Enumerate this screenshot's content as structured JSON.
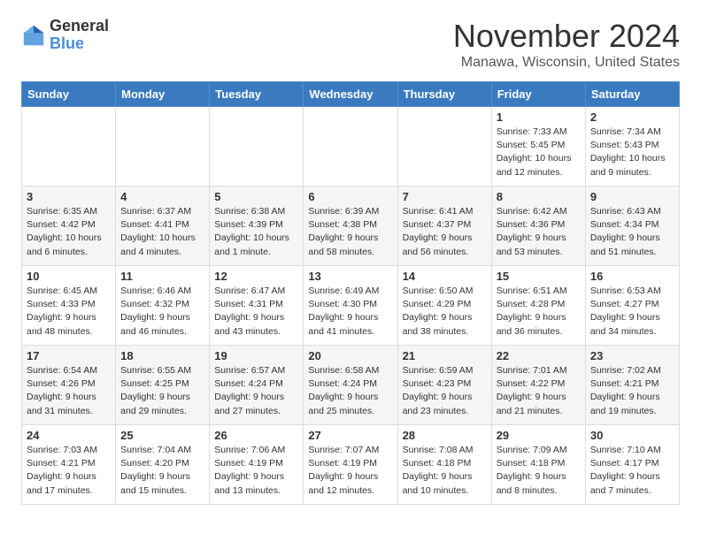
{
  "logo": {
    "general": "General",
    "blue": "Blue"
  },
  "header": {
    "month": "November 2024",
    "location": "Manawa, Wisconsin, United States"
  },
  "days_of_week": [
    "Sunday",
    "Monday",
    "Tuesday",
    "Wednesday",
    "Thursday",
    "Friday",
    "Saturday"
  ],
  "weeks": [
    [
      {
        "day": "",
        "info": ""
      },
      {
        "day": "",
        "info": ""
      },
      {
        "day": "",
        "info": ""
      },
      {
        "day": "",
        "info": ""
      },
      {
        "day": "",
        "info": ""
      },
      {
        "day": "1",
        "info": "Sunrise: 7:33 AM\nSunset: 5:45 PM\nDaylight: 10 hours and 12 minutes."
      },
      {
        "day": "2",
        "info": "Sunrise: 7:34 AM\nSunset: 5:43 PM\nDaylight: 10 hours and 9 minutes."
      }
    ],
    [
      {
        "day": "3",
        "info": "Sunrise: 6:35 AM\nSunset: 4:42 PM\nDaylight: 10 hours and 6 minutes."
      },
      {
        "day": "4",
        "info": "Sunrise: 6:37 AM\nSunset: 4:41 PM\nDaylight: 10 hours and 4 minutes."
      },
      {
        "day": "5",
        "info": "Sunrise: 6:38 AM\nSunset: 4:39 PM\nDaylight: 10 hours and 1 minute."
      },
      {
        "day": "6",
        "info": "Sunrise: 6:39 AM\nSunset: 4:38 PM\nDaylight: 9 hours and 58 minutes."
      },
      {
        "day": "7",
        "info": "Sunrise: 6:41 AM\nSunset: 4:37 PM\nDaylight: 9 hours and 56 minutes."
      },
      {
        "day": "8",
        "info": "Sunrise: 6:42 AM\nSunset: 4:36 PM\nDaylight: 9 hours and 53 minutes."
      },
      {
        "day": "9",
        "info": "Sunrise: 6:43 AM\nSunset: 4:34 PM\nDaylight: 9 hours and 51 minutes."
      }
    ],
    [
      {
        "day": "10",
        "info": "Sunrise: 6:45 AM\nSunset: 4:33 PM\nDaylight: 9 hours and 48 minutes."
      },
      {
        "day": "11",
        "info": "Sunrise: 6:46 AM\nSunset: 4:32 PM\nDaylight: 9 hours and 46 minutes."
      },
      {
        "day": "12",
        "info": "Sunrise: 6:47 AM\nSunset: 4:31 PM\nDaylight: 9 hours and 43 minutes."
      },
      {
        "day": "13",
        "info": "Sunrise: 6:49 AM\nSunset: 4:30 PM\nDaylight: 9 hours and 41 minutes."
      },
      {
        "day": "14",
        "info": "Sunrise: 6:50 AM\nSunset: 4:29 PM\nDaylight: 9 hours and 38 minutes."
      },
      {
        "day": "15",
        "info": "Sunrise: 6:51 AM\nSunset: 4:28 PM\nDaylight: 9 hours and 36 minutes."
      },
      {
        "day": "16",
        "info": "Sunrise: 6:53 AM\nSunset: 4:27 PM\nDaylight: 9 hours and 34 minutes."
      }
    ],
    [
      {
        "day": "17",
        "info": "Sunrise: 6:54 AM\nSunset: 4:26 PM\nDaylight: 9 hours and 31 minutes."
      },
      {
        "day": "18",
        "info": "Sunrise: 6:55 AM\nSunset: 4:25 PM\nDaylight: 9 hours and 29 minutes."
      },
      {
        "day": "19",
        "info": "Sunrise: 6:57 AM\nSunset: 4:24 PM\nDaylight: 9 hours and 27 minutes."
      },
      {
        "day": "20",
        "info": "Sunrise: 6:58 AM\nSunset: 4:24 PM\nDaylight: 9 hours and 25 minutes."
      },
      {
        "day": "21",
        "info": "Sunrise: 6:59 AM\nSunset: 4:23 PM\nDaylight: 9 hours and 23 minutes."
      },
      {
        "day": "22",
        "info": "Sunrise: 7:01 AM\nSunset: 4:22 PM\nDaylight: 9 hours and 21 minutes."
      },
      {
        "day": "23",
        "info": "Sunrise: 7:02 AM\nSunset: 4:21 PM\nDaylight: 9 hours and 19 minutes."
      }
    ],
    [
      {
        "day": "24",
        "info": "Sunrise: 7:03 AM\nSunset: 4:21 PM\nDaylight: 9 hours and 17 minutes."
      },
      {
        "day": "25",
        "info": "Sunrise: 7:04 AM\nSunset: 4:20 PM\nDaylight: 9 hours and 15 minutes."
      },
      {
        "day": "26",
        "info": "Sunrise: 7:06 AM\nSunset: 4:19 PM\nDaylight: 9 hours and 13 minutes."
      },
      {
        "day": "27",
        "info": "Sunrise: 7:07 AM\nSunset: 4:19 PM\nDaylight: 9 hours and 12 minutes."
      },
      {
        "day": "28",
        "info": "Sunrise: 7:08 AM\nSunset: 4:18 PM\nDaylight: 9 hours and 10 minutes."
      },
      {
        "day": "29",
        "info": "Sunrise: 7:09 AM\nSunset: 4:18 PM\nDaylight: 9 hours and 8 minutes."
      },
      {
        "day": "30",
        "info": "Sunrise: 7:10 AM\nSunset: 4:17 PM\nDaylight: 9 hours and 7 minutes."
      }
    ]
  ]
}
